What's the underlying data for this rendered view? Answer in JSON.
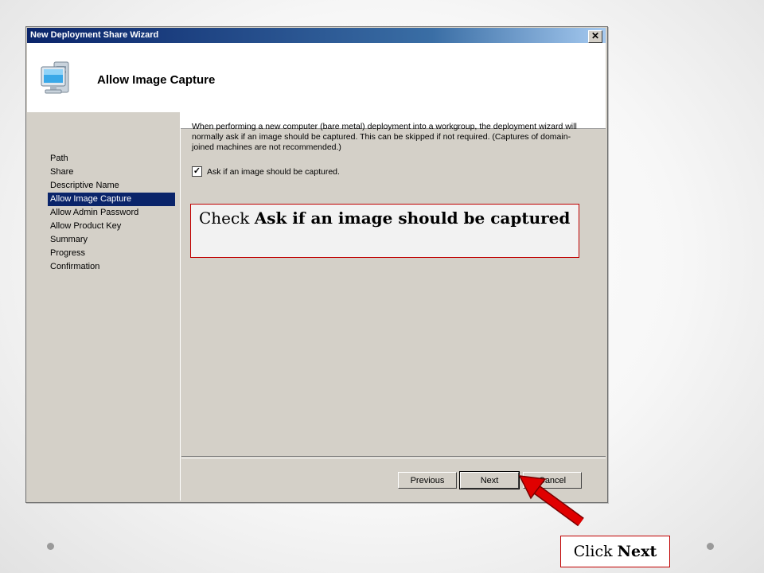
{
  "window": {
    "title": "New Deployment Share Wizard",
    "close_glyph": "✕"
  },
  "header": {
    "title": "Allow Image Capture",
    "icon": "computer-icon"
  },
  "sidebar": {
    "items": [
      {
        "label": "Path",
        "active": false
      },
      {
        "label": "Share",
        "active": false
      },
      {
        "label": "Descriptive Name",
        "active": false
      },
      {
        "label": "Allow Image Capture",
        "active": true
      },
      {
        "label": "Allow Admin Password",
        "active": false
      },
      {
        "label": "Allow Product Key",
        "active": false
      },
      {
        "label": "Summary",
        "active": false
      },
      {
        "label": "Progress",
        "active": false
      },
      {
        "label": "Confirmation",
        "active": false
      }
    ]
  },
  "content": {
    "description": "When performing a new computer (bare metal) deployment into a workgroup, the deployment wizard will normally ask if an image should be captured.  This can be skipped if not required.  (Captures of domain-joined machines are not recommended.)",
    "checkbox_label": "Ask if an image should be captured.",
    "checkbox_checked": true
  },
  "buttons": {
    "previous": "Previous",
    "next": "Next",
    "cancel": "Cancel"
  },
  "annotations": {
    "callout_prefix": "Check ",
    "callout_bold": "Ask if an image should be captured",
    "click_prefix": "Click ",
    "click_bold": "Next"
  },
  "colors": {
    "titlebar_start": "#0a246a",
    "selection": "#0a246a",
    "callout_border": "#c00000",
    "arrow": "#e00000"
  }
}
